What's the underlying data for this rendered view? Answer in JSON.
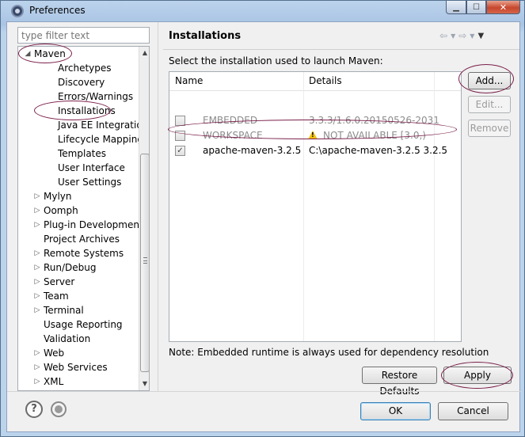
{
  "window": {
    "title": "Preferences"
  },
  "filter": {
    "placeholder": "type filter text"
  },
  "tree": {
    "maven": "Maven",
    "children": [
      "Archetypes",
      "Discovery",
      "Errors/Warnings",
      "Installations",
      "Java EE Integration",
      "Lifecycle Mappings",
      "Templates",
      "User Interface",
      "User Settings"
    ],
    "items": [
      "Mylyn",
      "Oomph",
      "Plug-in Development",
      "Project Archives",
      "Remote Systems",
      "Run/Debug",
      "Server",
      "Team",
      "Terminal",
      "Usage Reporting",
      "Validation",
      "Web",
      "Web Services",
      "XML"
    ],
    "selected": "Installations"
  },
  "page": {
    "title": "Installations",
    "description": "Select the installation used to launch Maven:",
    "note": "Note: Embedded runtime is always used for dependency resolution"
  },
  "table": {
    "columns": [
      "Name",
      "Details"
    ],
    "rows": [
      {
        "name": "EMBEDDED",
        "details": "3.3.3/1.6.0.20150526-2031",
        "checked": false,
        "disabled": true
      },
      {
        "name": "WORKSPACE",
        "details": "NOT AVAILABLE [3.0,)",
        "checked": false,
        "disabled": true,
        "warning": true
      },
      {
        "name": "apache-maven-3.2.5",
        "details": "C:\\apache-maven-3.2.5 3.2.5",
        "checked": true,
        "disabled": false
      }
    ]
  },
  "buttons": {
    "add": "Add...",
    "edit": "Edit...",
    "remove": "Remove",
    "restore_defaults": "Restore Defaults",
    "apply": "Apply",
    "ok": "OK",
    "cancel": "Cancel"
  },
  "icons": {
    "app": "eclipse-icon",
    "help": "help-icon",
    "record": "record-icon",
    "back": "back-arrow-icon",
    "forward": "forward-arrow-icon",
    "menu": "view-menu-icon",
    "warning": "warning-icon"
  },
  "colors": {
    "annotation": "#7a1f4a",
    "selection": "#cce8ff"
  }
}
